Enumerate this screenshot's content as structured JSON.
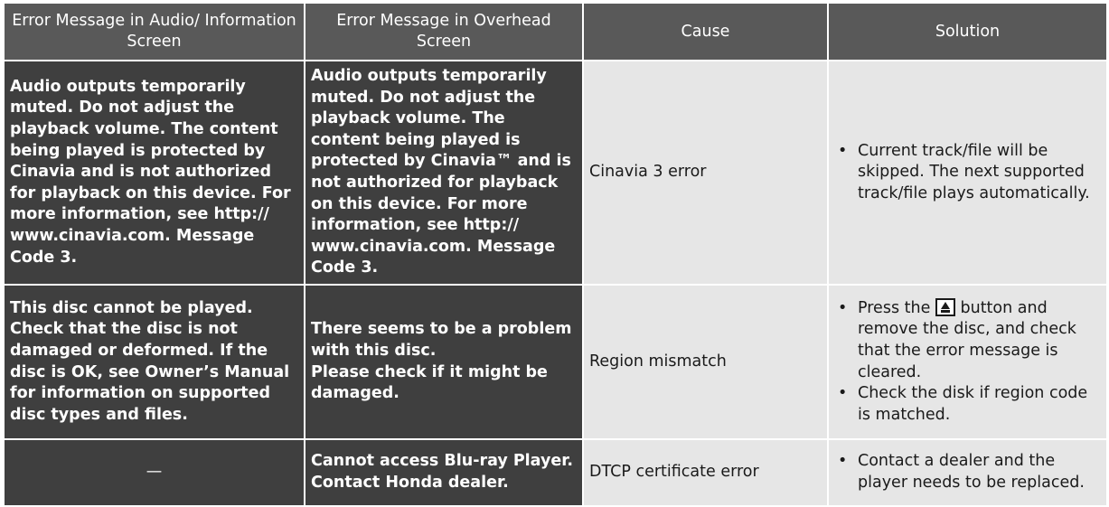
{
  "headers": {
    "audio_screen": "Error Message in Audio/ Information Screen",
    "overhead_screen": "Error Message in Overhead Screen",
    "cause": "Cause",
    "solution": "Solution"
  },
  "rows": [
    {
      "audio_msg": "Audio outputs temporarily muted. Do not adjust the playback volume. The content being played is protected by Cinavia and is not authorized for playback on this device. For more information, see http:// www.cinavia.com. Message Code 3.",
      "overhead_msg": "Audio outputs temporarily muted. Do not adjust the playback volume. The content being played is protected by Cinavia™ and is not authorized for playback on this device. For more information, see http:// www.cinavia.com. Message Code 3.",
      "cause": "Cinavia 3 error",
      "solution": [
        "Current track/file will be skipped. The next supported track/file plays automatically."
      ]
    },
    {
      "audio_msg": "This disc cannot be played. Check that the disc is not damaged or deformed. If the disc is OK, see Owner’s Manual for information on supported disc types and files.",
      "overhead_msg_line1": "There seems to be a problem with this disc.",
      "overhead_msg_line2": "Please check if it might be damaged.",
      "cause": "Region mismatch",
      "solution_1_before": "Press the",
      "solution_1_icon": "eject-icon",
      "solution_1_after": "button and remove the disc, and check that the error message is cleared.",
      "solution_2": "Check the disk if region code is matched."
    },
    {
      "audio_msg": "—",
      "overhead_msg_line1": "Cannot access Blu-ray Player.",
      "overhead_msg_line2": "Contact Honda dealer.",
      "cause": "DTCP certificate error",
      "solution": [
        "Contact a dealer and the player needs to be replaced."
      ]
    }
  ],
  "bullet": "•"
}
